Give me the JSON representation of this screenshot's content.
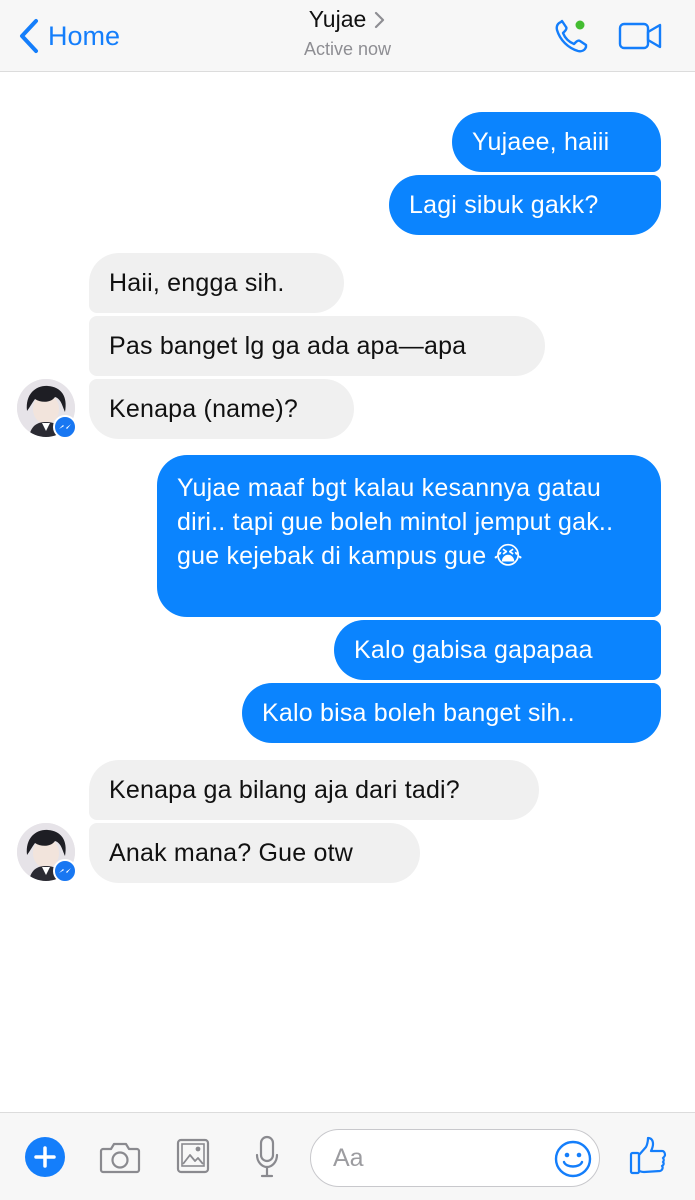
{
  "header": {
    "back_label": "Home",
    "contact_name": "Yujae",
    "status": "Active now",
    "accent_color": "#147efb",
    "active_dot_color": "#44bd32"
  },
  "messages": [
    {
      "side": "out",
      "text": "Yujaee, haiii"
    },
    {
      "side": "out",
      "text": "Lagi sibuk gakk?"
    },
    {
      "side": "in",
      "text": "Haii, engga sih."
    },
    {
      "side": "in",
      "text": "Pas banget lg ga ada apa—apa"
    },
    {
      "side": "in",
      "text": "Kenapa (name)?"
    },
    {
      "side": "out",
      "text": "Yujae maaf bgt kalau kesannya gatau diri.. tapi gue boleh mintol jemput gak.. gue kejebak di kampus gue 😭"
    },
    {
      "side": "out",
      "text": "Kalo gabisa gapapaa"
    },
    {
      "side": "out",
      "text": "Kalo bisa boleh banget sih.."
    },
    {
      "side": "in",
      "text": "Kenapa ga bilang aja dari tadi?"
    },
    {
      "side": "in",
      "text": "Anak mana? Gue otw"
    }
  ],
  "composer": {
    "placeholder": "Aa"
  },
  "icons": {
    "back": "chevron-left-icon",
    "call": "phone-icon",
    "video": "video-camera-icon",
    "add": "plus-circle-icon",
    "camera": "camera-icon",
    "gallery": "image-icon",
    "mic": "microphone-icon",
    "emoji": "smiley-icon",
    "like": "thumbs-up-icon"
  },
  "colors": {
    "outgoing_bubble": "#0b84fe",
    "incoming_bubble": "#f0f0f0",
    "messenger_badge": "#1877f2"
  }
}
